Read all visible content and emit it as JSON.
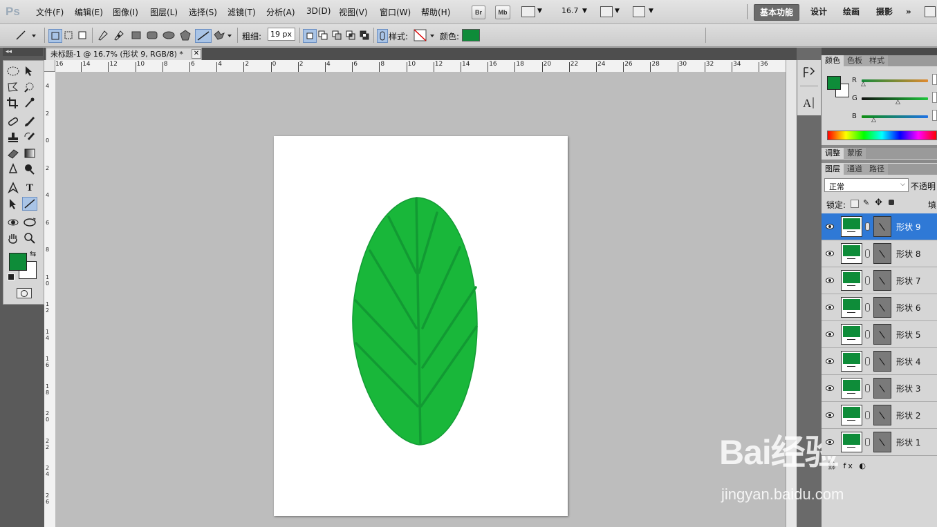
{
  "app": {
    "logo": "Ps"
  },
  "menu": [
    "文件(F)",
    "编辑(E)",
    "图像(I)",
    "图层(L)",
    "选择(S)",
    "滤镜(T)",
    "分析(A)",
    "3D(D)",
    "视图(V)",
    "窗口(W)",
    "帮助(H)"
  ],
  "menubar": {
    "br": "Br",
    "mb": "Mb",
    "zoom": "16.7"
  },
  "workspaces": [
    "基本功能",
    "设计",
    "绘画",
    "摄影",
    "»"
  ],
  "options": {
    "weight_label": "粗细:",
    "weight_value": "19 px",
    "style_label": "样式:",
    "color_label": "颜色:",
    "color": "#0e8c39"
  },
  "document": {
    "tab_title": "未标题-1 @ 16.7% (形状 9, RGB/8) *"
  },
  "rulers": {
    "h": [
      "16",
      "14",
      "12",
      "10",
      "8",
      "6",
      "4",
      "2",
      "0",
      "2",
      "4",
      "6",
      "8",
      "10",
      "12",
      "14",
      "16",
      "18",
      "20",
      "22",
      "24",
      "26",
      "28",
      "30",
      "32",
      "34",
      "36"
    ],
    "v": [
      "4",
      "2",
      "0",
      "2",
      "4",
      "6",
      "8",
      "10",
      "12",
      "14",
      "16",
      "18",
      "20",
      "22",
      "24",
      "26"
    ]
  },
  "colors": {
    "foreground": "#0e8c39",
    "background": "#ffffff",
    "leaf": "#19b73a",
    "vein": "#129a33",
    "leaf_edge": "#139c35"
  },
  "color_panel": {
    "tabs": [
      "颜色",
      "色板",
      "样式"
    ],
    "channels": [
      "R",
      "G",
      "B"
    ]
  },
  "adjust_panel": {
    "tabs": [
      "调整",
      "蒙版"
    ]
  },
  "layers_panel": {
    "tabs": [
      "图层",
      "通道",
      "路径"
    ],
    "blend_mode": "正常",
    "opacity_label": "不透明",
    "lock_label": "锁定:",
    "fill_label": "填",
    "layers": [
      {
        "name": "形状 9",
        "selected": true
      },
      {
        "name": "形状 8",
        "selected": false
      },
      {
        "name": "形状 7",
        "selected": false
      },
      {
        "name": "形状 6",
        "selected": false
      },
      {
        "name": "形状 5",
        "selected": false
      },
      {
        "name": "形状 4",
        "selected": false
      },
      {
        "name": "形状 3",
        "selected": false
      },
      {
        "name": "形状 2",
        "selected": false
      },
      {
        "name": "形状 1",
        "selected": false
      }
    ]
  },
  "watermark": {
    "text": "Bai经验",
    "url": "jingyan.baidu.com"
  }
}
